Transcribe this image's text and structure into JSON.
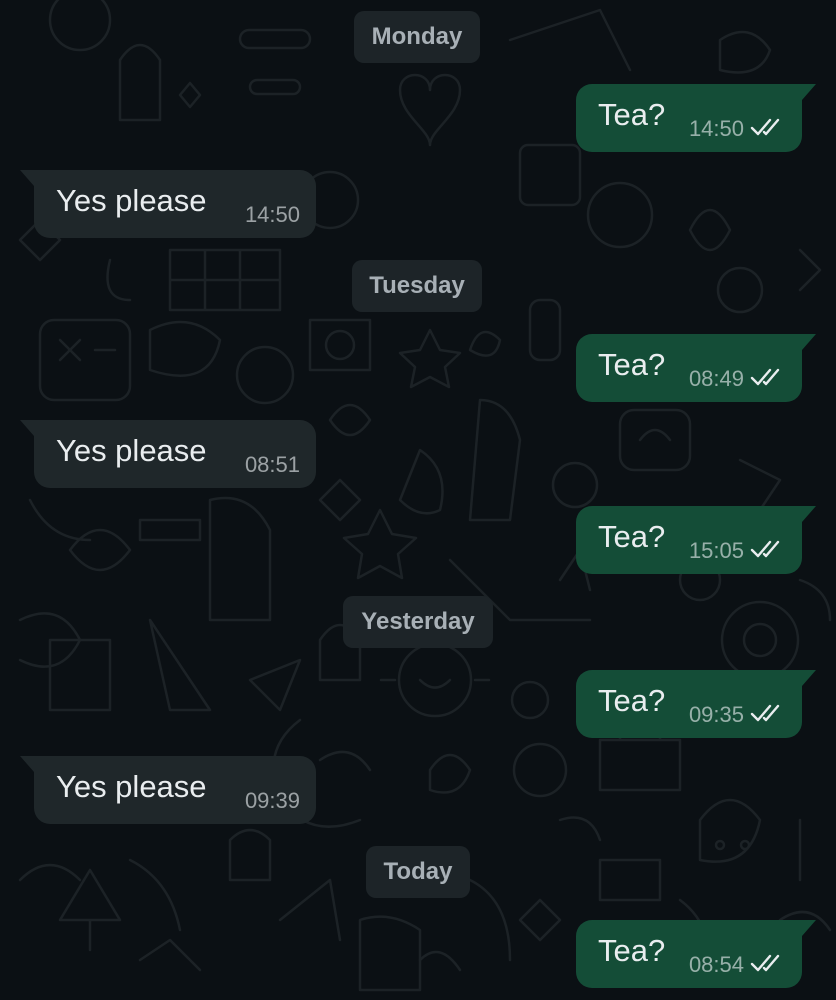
{
  "chat": {
    "days": [
      {
        "label": "Monday"
      },
      {
        "label": "Tuesday"
      },
      {
        "label": "Yesterday"
      },
      {
        "label": "Today"
      }
    ],
    "messages": [
      {
        "direction": "out",
        "text": "Tea?",
        "time": "14:50",
        "status": "read"
      },
      {
        "direction": "in",
        "text": "Yes please",
        "time": "14:50"
      },
      {
        "direction": "out",
        "text": "Tea?",
        "time": "08:49",
        "status": "read"
      },
      {
        "direction": "in",
        "text": "Yes please",
        "time": "08:51"
      },
      {
        "direction": "out",
        "text": "Tea?",
        "time": "15:05",
        "status": "read"
      },
      {
        "direction": "out",
        "text": "Tea?",
        "time": "09:35",
        "status": "read"
      },
      {
        "direction": "in",
        "text": "Yes please",
        "time": "09:39"
      },
      {
        "direction": "out",
        "text": "Tea?",
        "time": "08:54",
        "status": "read"
      }
    ]
  },
  "colors": {
    "background": "#0b1014",
    "outgoing_bubble": "#144d37",
    "incoming_bubble": "#1f272a",
    "date_chip": "#1d2428",
    "text": "#e9edef",
    "read_ticks": "#e9edef"
  },
  "icons": {
    "read_receipt": "double-check-icon"
  }
}
